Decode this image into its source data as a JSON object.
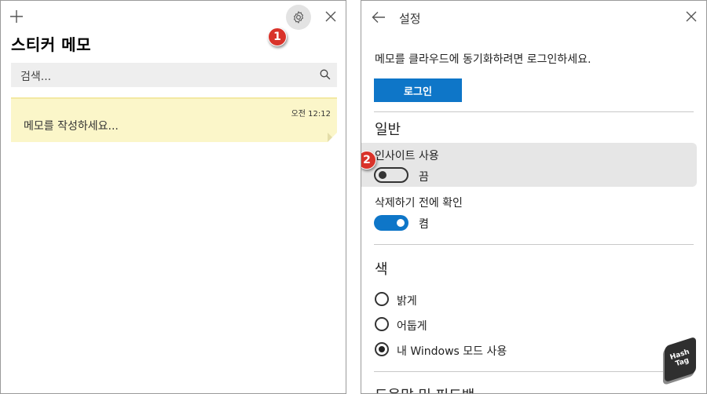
{
  "left": {
    "title": "스티커 메모",
    "search_placeholder": "검색...",
    "note": {
      "time": "오전 12:12",
      "text": "메모를 작성하세요..."
    },
    "badge": "1"
  },
  "right": {
    "header_title": "설정",
    "sync_text": "메모를 클라우드에 동기화하려면 로그인하세요.",
    "login_label": "로그인",
    "general_heading": "일반",
    "insights": {
      "label": "인사이트 사용",
      "state": "끔",
      "on": false,
      "badge": "2"
    },
    "confirm_delete": {
      "label": "삭제하기 전에 확인",
      "state": "켬",
      "on": true
    },
    "color_heading": "색",
    "color_options": [
      {
        "label": "밝게",
        "selected": false
      },
      {
        "label": "어둡게",
        "selected": false
      },
      {
        "label": "내 Windows 모드 사용",
        "selected": true
      }
    ],
    "help_heading": "도움말 및 피드백"
  },
  "watermark": {
    "line1": "Hash",
    "line2": "Tag"
  },
  "colors": {
    "accent": "#0e76c8",
    "note_bg": "#fbf6c9",
    "badge": "#d9332a"
  }
}
